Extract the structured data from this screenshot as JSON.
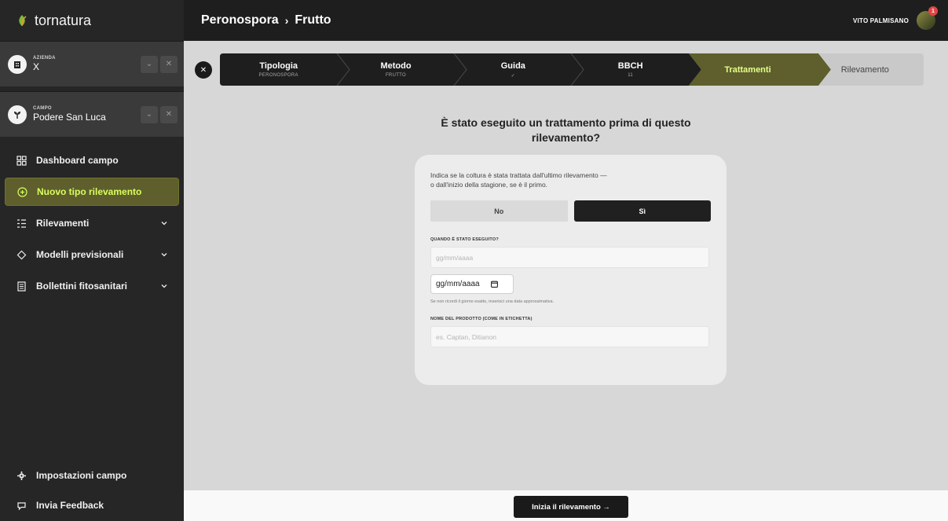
{
  "app": {
    "name": "tornatura"
  },
  "sidebar": {
    "azienda": {
      "label": "AZIENDA",
      "value": "X"
    },
    "campo": {
      "label": "CAMPO",
      "value": "Podere San Luca"
    },
    "items": [
      {
        "label": "Dashboard campo",
        "icon": "grid-icon"
      },
      {
        "label": "Nuovo tipo rilevamento",
        "icon": "plus-circle-icon",
        "active": true
      },
      {
        "label": "Rilevamenti",
        "icon": "list-icon"
      },
      {
        "label": "Modelli previsionali",
        "icon": "diamond-icon"
      },
      {
        "label": "Bollettini fitosanitari",
        "icon": "document-icon"
      }
    ],
    "bottom": [
      {
        "label": "Impostazioni campo",
        "icon": "gear-icon"
      },
      {
        "label": "Invia Feedback",
        "icon": "chat-icon"
      }
    ]
  },
  "header": {
    "crumb_1": "Peronospora",
    "sep": "›",
    "crumb_2": "Frutto",
    "user_name": "VITO PALMISANO",
    "notif_count": "1"
  },
  "stepper": [
    {
      "title": "Tipologia",
      "sub": "PERONOSPORA"
    },
    {
      "title": "Metodo",
      "sub": "FRUTTO"
    },
    {
      "title": "Guida",
      "sub": "✓"
    },
    {
      "title": "BBCH",
      "sub": "11"
    },
    {
      "title": "Trattamenti",
      "sub": ""
    },
    {
      "title": "Rilevamento",
      "sub": ""
    }
  ],
  "form": {
    "question_1": "È stato eseguito un trattamento prima di questo",
    "question_2": "rilevamento?",
    "intro_1": "Indica se la coltura è stata trattata dall'ultimo rilevamento —",
    "intro_2": "o dall'inizio della stagione, se è il primo.",
    "no_label": "No",
    "si_label": "Sì",
    "date_label": "QUANDO È STATO ESEGUITO?",
    "date_placeholder": "gg/mm/aaaa",
    "date_native_value": "gg/mm/aaaa",
    "date_hint": "Se non ricordi il giorno esatto, inserisci una data approssimativa.",
    "product_label": "NOME DEL PRODOTTO (COME IN ETICHETTA)",
    "product_placeholder": "es. Captan, Ditianon"
  },
  "footer": {
    "cta_label": "Inizia il rilevamento →"
  },
  "colors": {
    "accent": "#d9ff5e",
    "active_bg": "#5e5f2c",
    "stepper_dark": "#1e1e1e",
    "stepper_current": "#5e5f2c",
    "stepper_future": "#c9c9c9"
  }
}
